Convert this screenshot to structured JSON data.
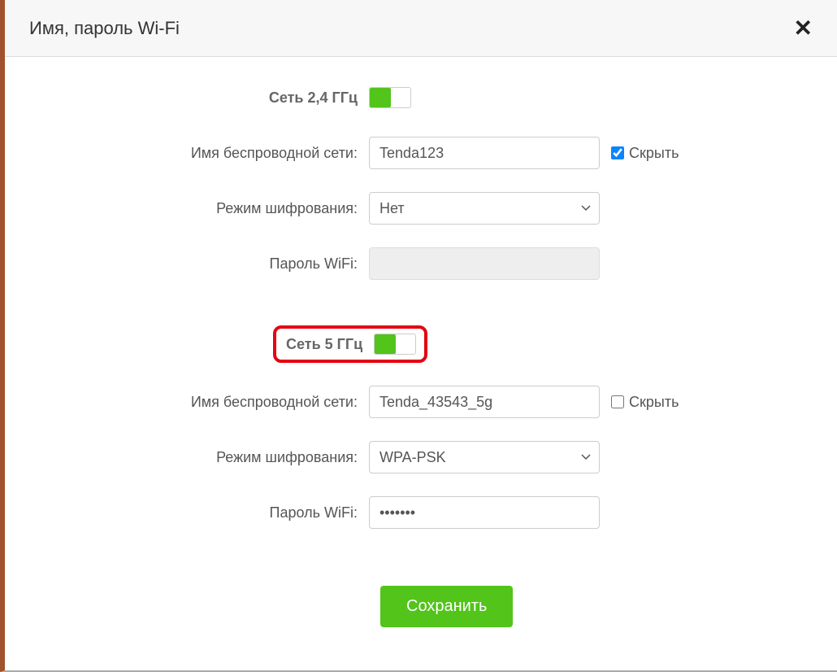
{
  "header": {
    "title": "Имя, пароль Wi-Fi"
  },
  "band24": {
    "section_label": "Сеть 2,4 ГГц",
    "toggle_on": true,
    "ssid_label": "Имя беспроводной сети:",
    "ssid_value": "Tenda123",
    "hide_label": "Скрыть",
    "hide_checked": true,
    "encryption_label": "Режим шифрования:",
    "encryption_value": "Нет",
    "password_label": "Пароль WiFi:",
    "password_value": ""
  },
  "band5": {
    "section_label": "Сеть 5 ГГц",
    "toggle_on": true,
    "ssid_label": "Имя беспроводной сети:",
    "ssid_value": "Tenda_43543_5g",
    "hide_label": "Скрыть",
    "hide_checked": false,
    "encryption_label": "Режим шифрования:",
    "encryption_value": "WPA-PSK",
    "password_label": "Пароль WiFi:",
    "password_value": "•••••••"
  },
  "actions": {
    "save_label": "Сохранить"
  }
}
